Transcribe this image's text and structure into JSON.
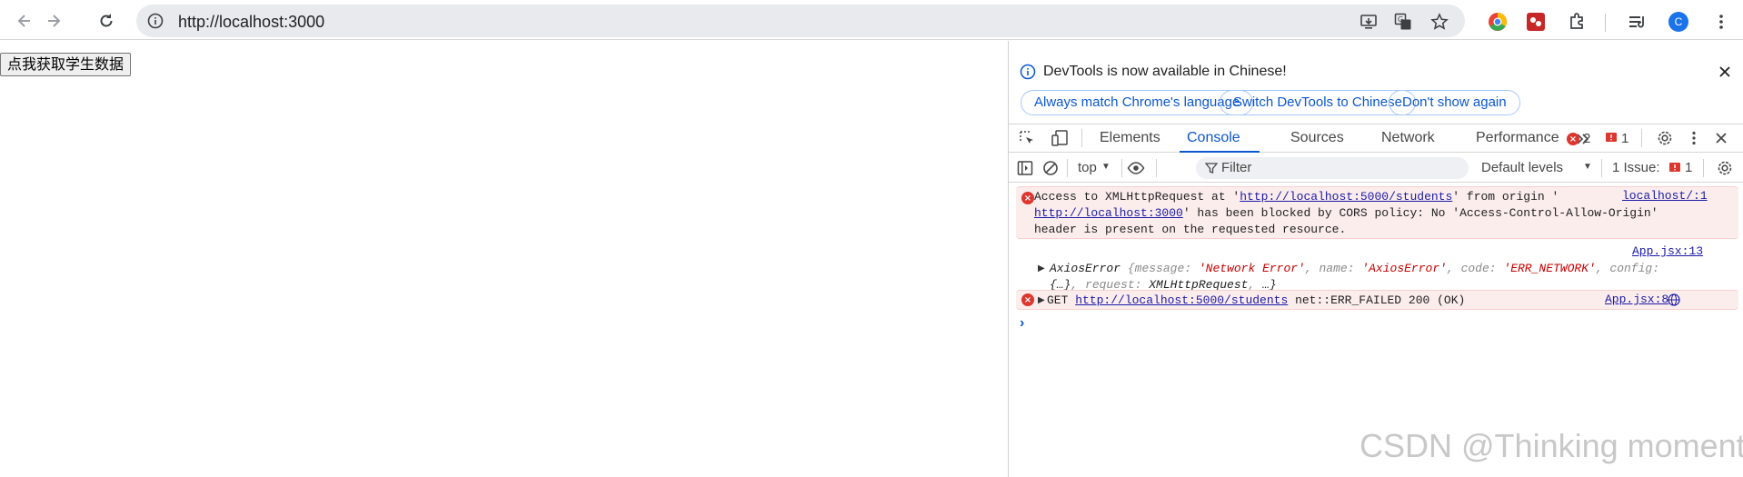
{
  "browser": {
    "url": "http://localhost:3000",
    "profile_initial": "C"
  },
  "page": {
    "button_label": "点我获取学生数据"
  },
  "devtools": {
    "notice": {
      "text": "DevTools is now available in Chinese!",
      "buttons": [
        "Always match Chrome's language",
        "Switch DevTools to Chinese",
        "Don't show again"
      ]
    },
    "tabs": [
      "Elements",
      "Console",
      "Sources",
      "Network",
      "Performance"
    ],
    "active_tab": "Console",
    "error_count": "2",
    "issue_count": "1",
    "context": "top",
    "filter_placeholder": "Filter",
    "levels": "Default levels",
    "issues_label": "1 Issue:",
    "issues_badge": "1",
    "messages": {
      "cors": {
        "part1": "Access to XMLHttpRequest at '",
        "link1": "http://localhost:5000/students",
        "part2": "' from origin '",
        "link2": "http://localhost:3000",
        "part3": "' has been blocked by CORS policy: No 'Access-Control-Allow-Origin'",
        "line3": "header is present on the requested resource.",
        "source": "localhost/:1"
      },
      "axios": {
        "source": "App.jsx:13",
        "name": "AxiosError",
        "k1": "message",
        "v1": "'Network Error'",
        "k2": "name",
        "v2": "'AxiosError'",
        "k3": "code",
        "v3": "'ERR_NETWORK'",
        "k4": "config",
        "line2a": "{…}",
        "k5": "request",
        "v5": "XMLHttpRequest",
        "more": "…}"
      },
      "get": {
        "method": "GET",
        "link": "http://localhost:5000/students",
        "status": "net::ERR_FAILED 200 (OK)",
        "source": "App.jsx:8"
      }
    },
    "colors": {
      "accent": "#0b57d0",
      "error": "#dc362e",
      "error_bg": "#fceded"
    }
  },
  "watermark": "CSDN @Thinking moment"
}
